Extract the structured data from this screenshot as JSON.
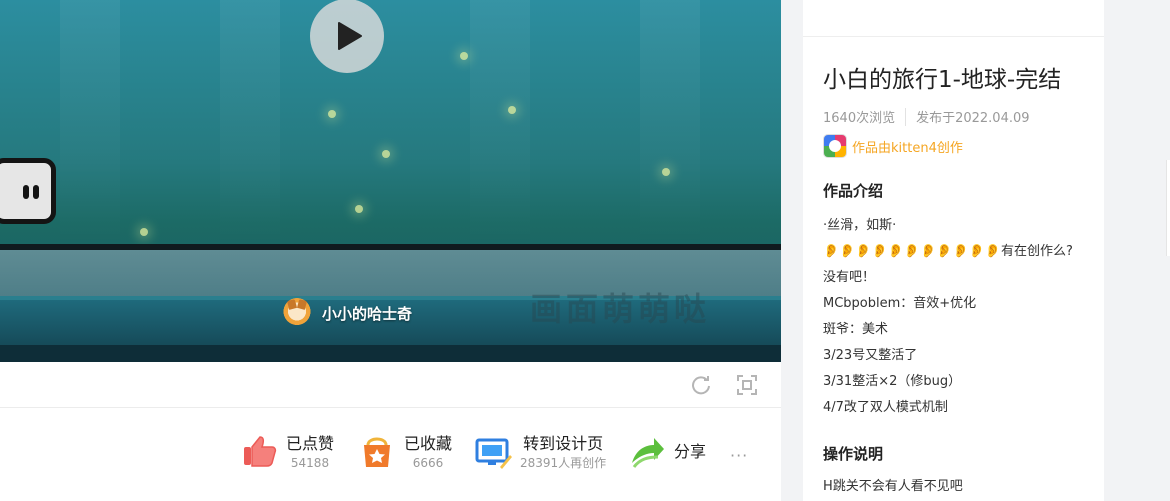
{
  "player": {
    "author_name": "小小的哈士奇",
    "watermark": "画面萌萌哒"
  },
  "actions": {
    "like": {
      "label": "已点赞",
      "count": "54188"
    },
    "collect": {
      "label": "已收藏",
      "count": "6666"
    },
    "design": {
      "label": "转到设计页",
      "sub": "28391人再创作"
    },
    "share": {
      "label": "分享"
    },
    "more": "···"
  },
  "work": {
    "title": "小白的旅行1-地球-完结",
    "views": "1640次浏览",
    "published": "发布于2022.04.09",
    "made_with": "作品由kitten4创作",
    "intro_heading": "作品介绍",
    "intro_lines": [
      "·丝滑，如斯·",
      "👂👂👂👂👂👂👂👂👂👂👂有在创作么?没有吧！",
      "MCbpoblem：音效+优化",
      "斑爷：美术",
      "3/23号又整活了",
      "3/31整活×2（修bug）",
      "4/7改了双人模式机制"
    ],
    "ops_heading": "操作说明",
    "ops_text": "H跳关不会有人看不见吧"
  },
  "colors": {
    "accent_yellow": "#f5a623",
    "like_red": "#ec5b57",
    "share_green": "#5cbf3d",
    "design_blue": "#2f7fe0"
  },
  "icons": [
    "play-icon",
    "refresh-icon",
    "fullscreen-icon",
    "like-icon",
    "collect-icon",
    "design-icon",
    "share-icon",
    "kitten-logo-icon"
  ]
}
